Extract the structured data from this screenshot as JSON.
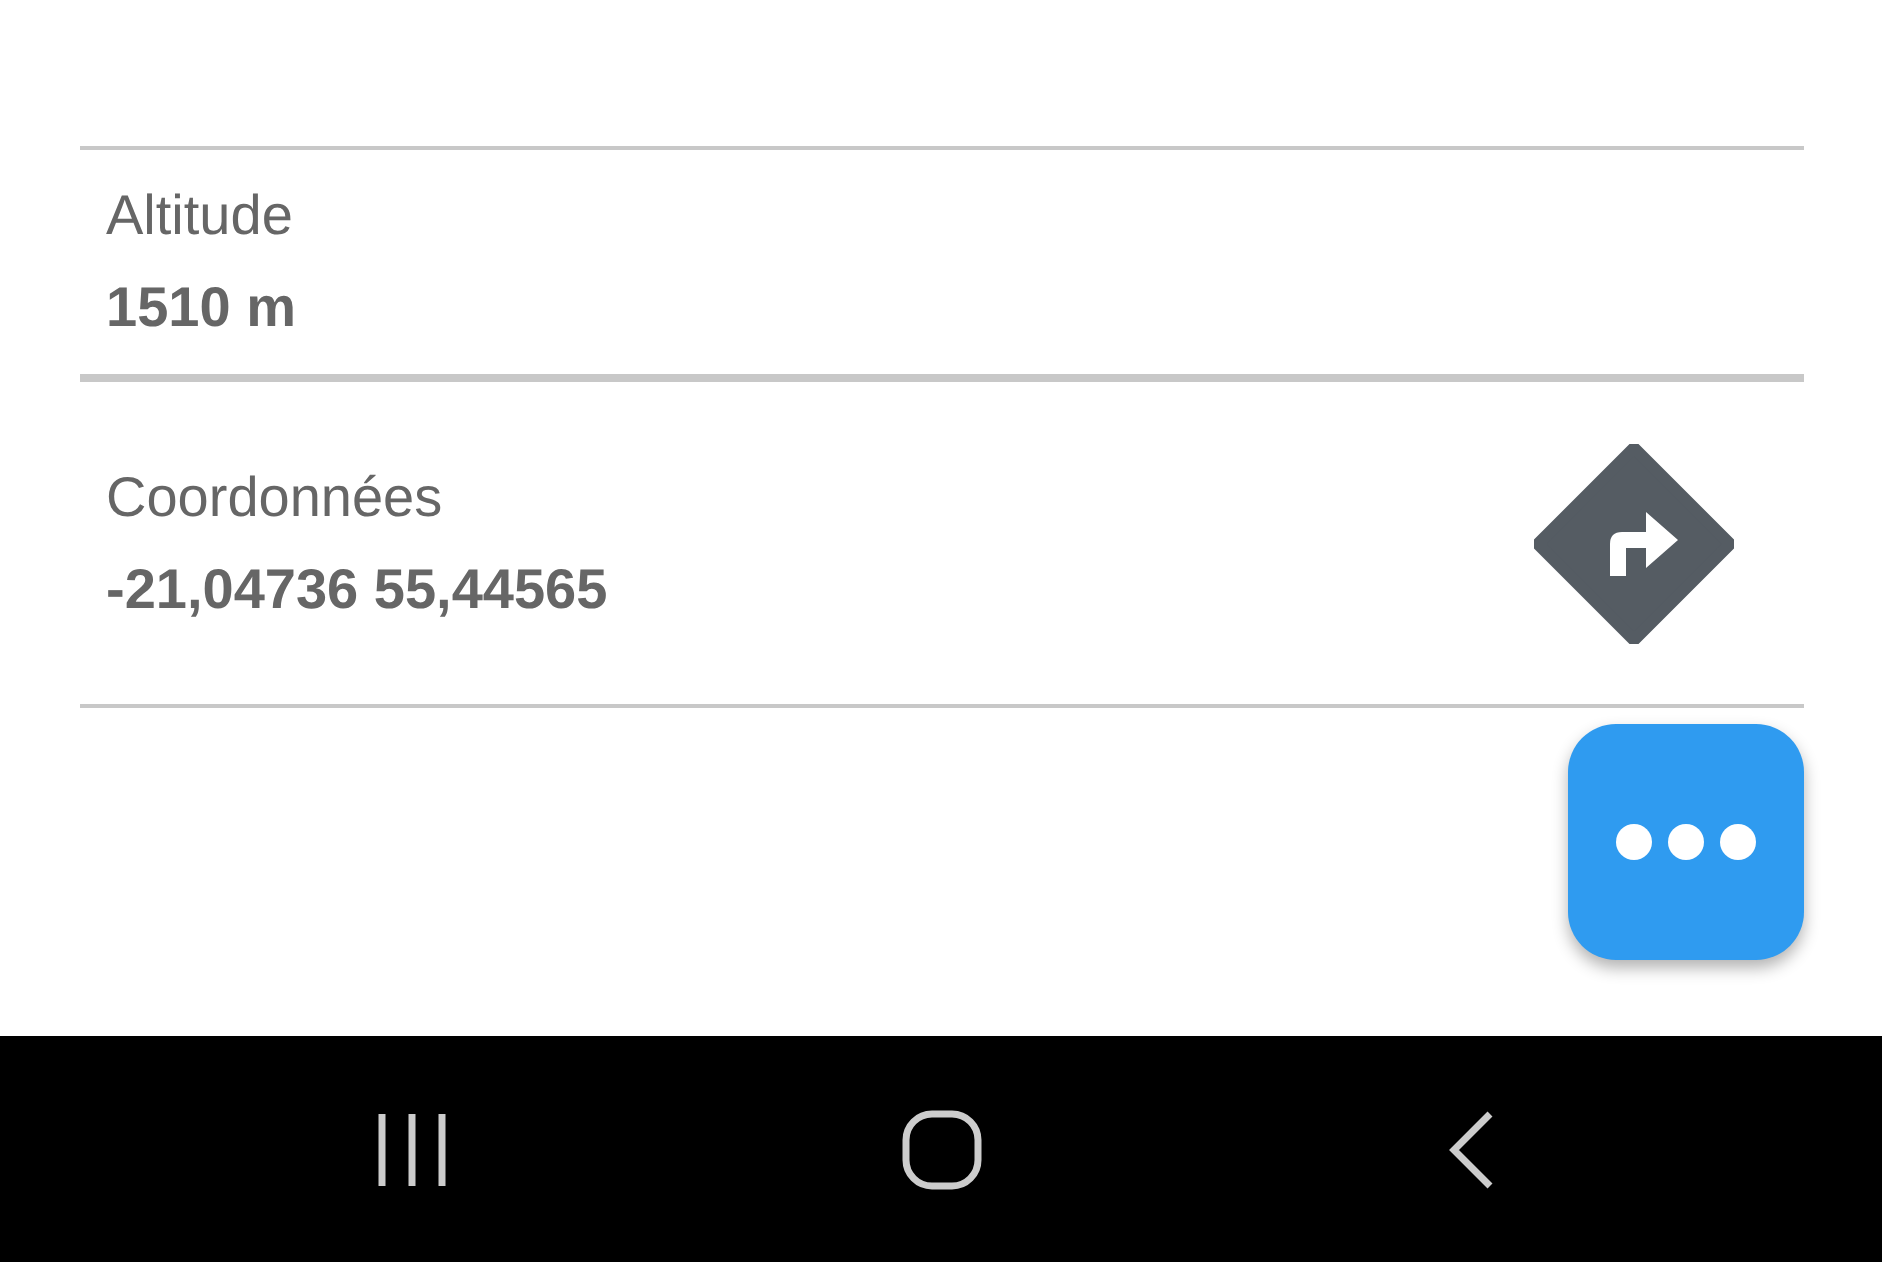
{
  "details": [
    {
      "label": "Altitude",
      "value": "1510 m",
      "kind": "plain"
    },
    {
      "label": "Coordonnées",
      "value": "-21,04736 55,44565",
      "kind": "directions"
    }
  ],
  "nav_bar": {
    "buttons": [
      {
        "kind": "recents"
      },
      {
        "kind": "home"
      },
      {
        "kind": "back"
      }
    ]
  }
}
